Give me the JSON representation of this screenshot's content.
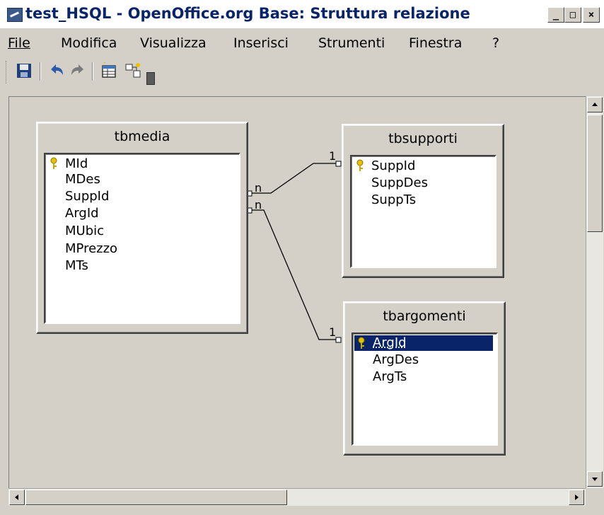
{
  "window": {
    "title": "test_HSQL - OpenOffice.org Base: Struttura relazione",
    "min_glyph": "_",
    "max_glyph": "□",
    "close_glyph": "×"
  },
  "menu": [
    {
      "label": "File"
    },
    {
      "label": "Modifica"
    },
    {
      "label": "Visualizza"
    },
    {
      "label": "Inserisci"
    },
    {
      "label": "Strumenti"
    },
    {
      "label": "Finestra"
    },
    {
      "label": "?"
    }
  ],
  "toolbar": {
    "icons": [
      "save-icon",
      "undo-icon",
      "redo-icon",
      "add-table-icon",
      "new-relation-icon"
    ]
  },
  "tables": {
    "tbmedia": {
      "name": "tbmedia",
      "fields": [
        "MId",
        "MDes",
        "SuppId",
        "ArgId",
        "MUbic",
        "MPrezzo",
        "MTs"
      ],
      "key_field": "MId"
    },
    "tbsupporti": {
      "name": "tbsupporti",
      "fields": [
        "SuppId",
        "SuppDes",
        "SuppTs"
      ],
      "key_field": "SuppId"
    },
    "tbargomenti": {
      "name": "tbargomenti",
      "fields": [
        "ArgId",
        "ArgDes",
        "ArgTs"
      ],
      "key_field": "ArgId",
      "selected_field": "ArgId"
    }
  },
  "relations": {
    "supp": {
      "from_card": "n",
      "to_card": "1"
    },
    "arg": {
      "from_card": "n",
      "to_card": "1"
    }
  },
  "colors": {
    "title_text": "#0a246a",
    "selection": "#0a246a",
    "canvas": "#d4d0c8"
  }
}
